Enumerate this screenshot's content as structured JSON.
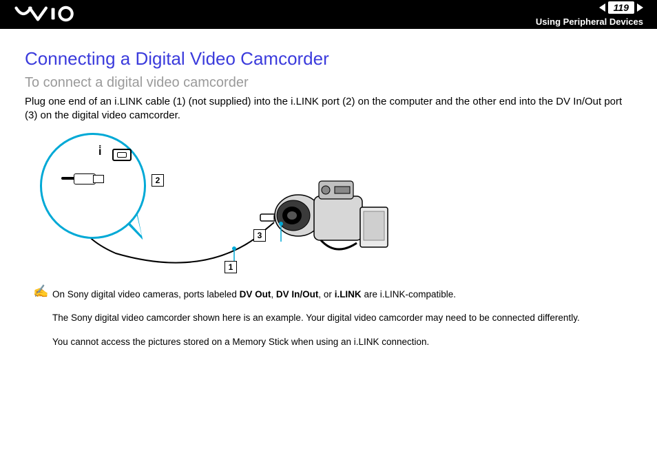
{
  "header": {
    "page_number": "119",
    "section": "Using Peripheral Devices"
  },
  "title": "Connecting a Digital Video Camcorder",
  "subtitle": "To connect a digital video camcorder",
  "body_text": "Plug one end of an i.LINK cable (1) (not supplied) into the i.LINK port (2) on the computer and the other end into the DV In/Out port (3) on the digital video camcorder.",
  "diagram": {
    "label1": "1",
    "label2": "2",
    "label3": "3"
  },
  "notes": {
    "n1_pre": "On Sony digital video cameras, ports labeled ",
    "n1_b1": "DV Out",
    "n1_m1": ", ",
    "n1_b2": "DV In/Out",
    "n1_m2": ", or ",
    "n1_b3": "i.LINK",
    "n1_post": " are i.LINK-compatible.",
    "n2": "The Sony digital video camcorder shown here is an example. Your digital video camcorder may need to be connected differently.",
    "n3": "You cannot access the pictures stored on a Memory Stick when using an i.LINK connection."
  }
}
